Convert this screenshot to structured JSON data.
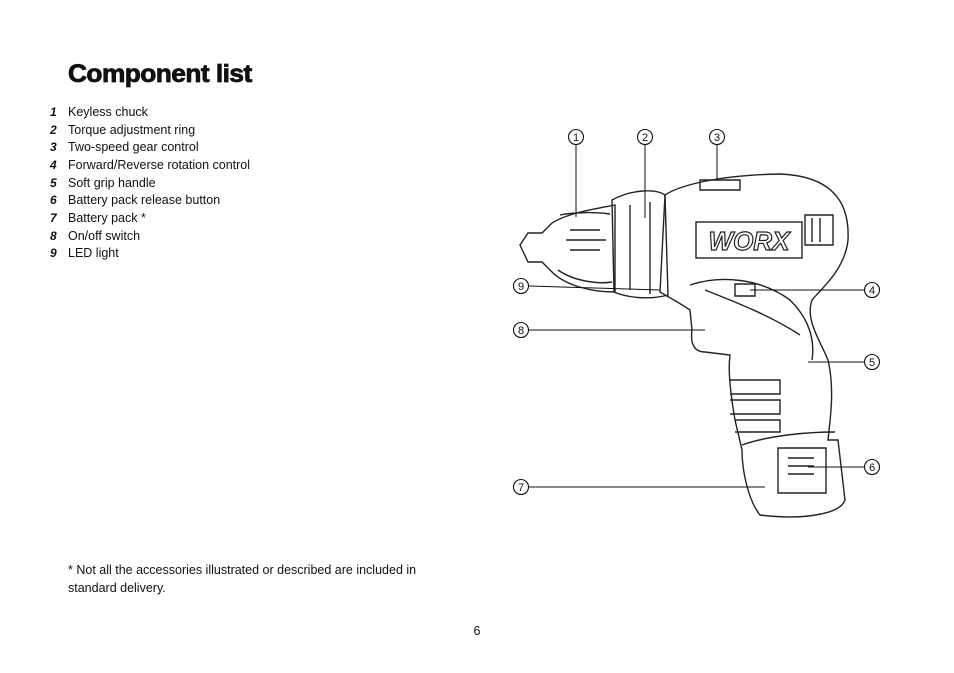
{
  "heading": "Component list",
  "components": [
    {
      "number": "1",
      "label": "Keyless chuck"
    },
    {
      "number": "2",
      "label": "Torque adjustment ring"
    },
    {
      "number": "3",
      "label": "Two-speed gear control"
    },
    {
      "number": "4",
      "label": "Forward/Reverse rotation control"
    },
    {
      "number": "5",
      "label": "Soft grip handle"
    },
    {
      "number": "6",
      "label": "Battery pack release button"
    },
    {
      "number": "7",
      "label": "Battery pack *"
    },
    {
      "number": "8",
      "label": "On/off switch"
    },
    {
      "number": "9",
      "label": "LED light"
    }
  ],
  "footnote": "* Not all the accessories illustrated or described are included in standard delivery.",
  "page_number": "6",
  "illustration": {
    "brand_logo": "WORX",
    "callouts": [
      "1",
      "2",
      "3",
      "4",
      "5",
      "6",
      "7",
      "8",
      "9"
    ]
  }
}
